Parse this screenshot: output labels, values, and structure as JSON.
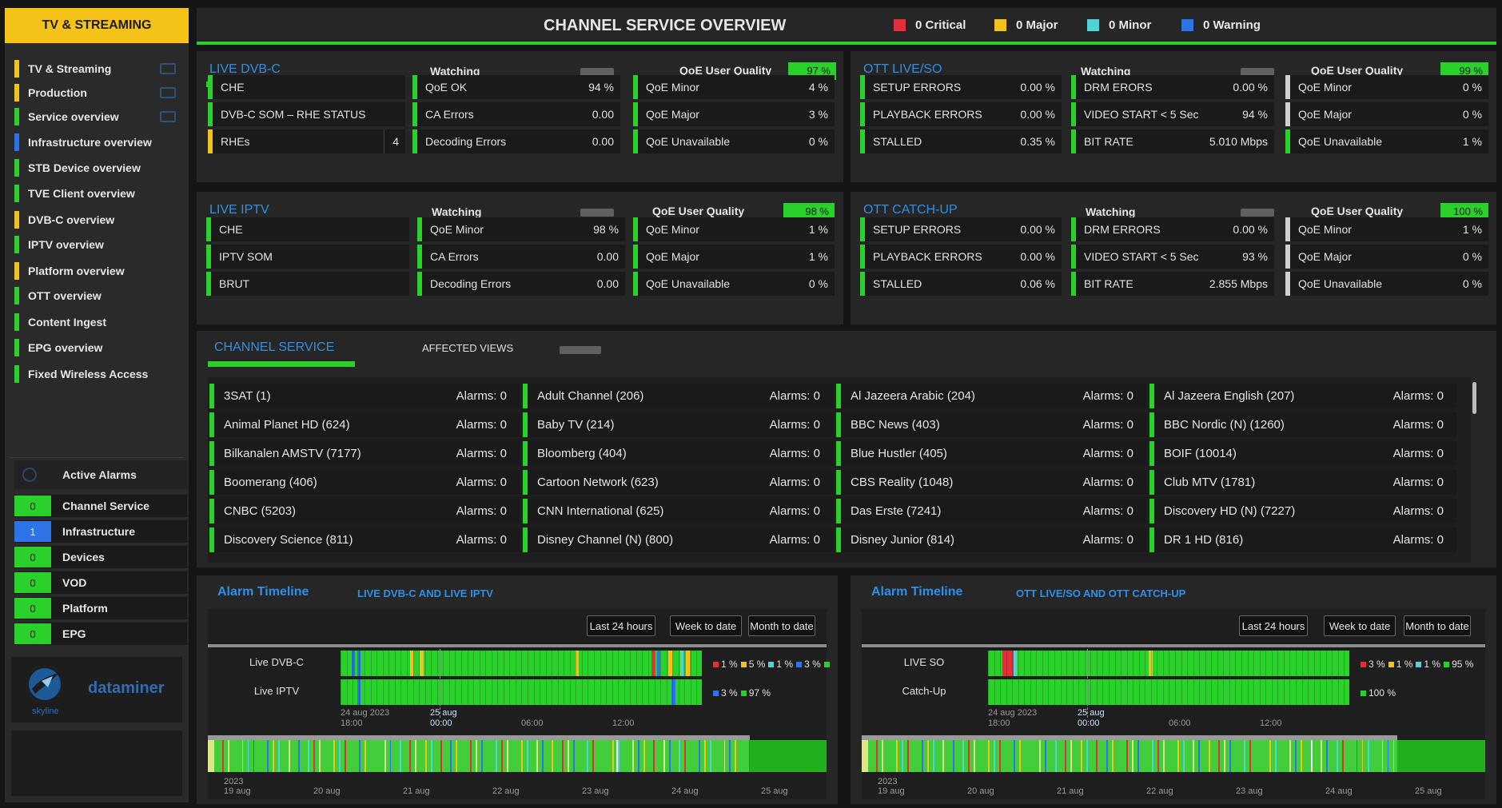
{
  "colors": {
    "green": "#2bd12b",
    "yellow": "#f1c21b",
    "critical": "#e0303a",
    "major": "#f1c21b",
    "minor": "#4fd2d8",
    "warning": "#2f74e6",
    "blue_title": "#2e8fe6"
  },
  "sidebar": {
    "title": "TV & STREAMING",
    "items": [
      {
        "label": "TV & Streaming",
        "color": "#f1c21b",
        "icon": true
      },
      {
        "label": "Production",
        "color": "#f1c21b",
        "icon": true
      },
      {
        "label": "Service overview",
        "color": "#2bd12b",
        "icon": true
      },
      {
        "label": "Infrastructure overview",
        "color": "#2f74e6",
        "icon": false
      },
      {
        "label": "STB Device overview",
        "color": "#2bd12b",
        "icon": false
      },
      {
        "label": "TVE Client overview",
        "color": "#2bd12b",
        "icon": false
      },
      {
        "label": "DVB-C overview",
        "color": "#f1c21b",
        "icon": false
      },
      {
        "label": "IPTV overview",
        "color": "#2bd12b",
        "icon": false
      },
      {
        "label": "Platform overview",
        "color": "#f1c21b",
        "icon": false
      },
      {
        "label": "OTT overview",
        "color": "#2bd12b",
        "icon": false
      },
      {
        "label": "Content Ingest",
        "color": "#2bd12b",
        "icon": false
      },
      {
        "label": "EPG overview",
        "color": "#2bd12b",
        "icon": false
      },
      {
        "label": "Fixed Wireless Access",
        "color": "#2bd12b",
        "icon": false
      }
    ],
    "alarms_title": "Active Alarms",
    "alarms": [
      {
        "count": "0",
        "label": "Channel Service",
        "color": "#2bd12b"
      },
      {
        "count": "1",
        "label": "Infrastructure",
        "color": "#2f74e6"
      },
      {
        "count": "0",
        "label": "Devices",
        "color": "#2bd12b"
      },
      {
        "count": "0",
        "label": "VOD",
        "color": "#2bd12b"
      },
      {
        "count": "0",
        "label": "Platform",
        "color": "#2bd12b"
      },
      {
        "count": "0",
        "label": "EPG",
        "color": "#2bd12b"
      }
    ],
    "logo_brand": "skyline",
    "logo_name": "dataminer"
  },
  "header": {
    "title": "CHANNEL SERVICE OVERVIEW",
    "legend": [
      {
        "label": "0 Critical",
        "color": "#e0303a"
      },
      {
        "label": "0 Major",
        "color": "#f1c21b"
      },
      {
        "label": "0 Minor",
        "color": "#4fd2d8"
      },
      {
        "label": "0 Warning",
        "color": "#2f74e6"
      }
    ]
  },
  "panels": [
    {
      "title": "LIVE DVB-C",
      "watching": "Watching",
      "qoe": "QoE User Quality",
      "qoe_value": "97 %",
      "cols": [
        [
          {
            "label": "CHE",
            "value": "",
            "color": "g"
          },
          {
            "label": "DVB-C SOM – RHE STATUS",
            "value": "",
            "color": "g"
          },
          {
            "label": "RHEs",
            "value": "4",
            "color": "y"
          }
        ],
        [
          {
            "label": "QoE OK",
            "value": "94 %",
            "color": "g"
          },
          {
            "label": "CA Errors",
            "value": "0.00",
            "color": "g"
          },
          {
            "label": "Decoding Errors",
            "value": "0.00",
            "color": "g"
          }
        ],
        [
          {
            "label": "QoE Minor",
            "value": "4 %",
            "color": "g"
          },
          {
            "label": "QoE Major",
            "value": "3 %",
            "color": "g"
          },
          {
            "label": "QoE Unavailable",
            "value": "0 %",
            "color": "g"
          }
        ]
      ]
    },
    {
      "title": "OTT LIVE/SO",
      "watching": "Watching",
      "qoe": "QoE User Quality",
      "qoe_value": "99 %",
      "cols": [
        [
          {
            "label": "SETUP ERRORS",
            "value": "0.00 %",
            "color": "g"
          },
          {
            "label": "PLAYBACK ERRORS",
            "value": "0.00 %",
            "color": "g"
          },
          {
            "label": "STALLED",
            "value": "0.35 %",
            "color": "g"
          }
        ],
        [
          {
            "label": "DRM ERORS",
            "value": "0.00 %",
            "color": "g"
          },
          {
            "label": "VIDEO START  < 5 Sec",
            "value": "94 %",
            "color": "g"
          },
          {
            "label": "BIT RATE",
            "value": "5.010 Mbps",
            "color": "g"
          }
        ],
        [
          {
            "label": "QoE Minor",
            "value": "0 %",
            "color": "w"
          },
          {
            "label": "QoE Major",
            "value": "0 %",
            "color": "w"
          },
          {
            "label": "QoE Unavailable",
            "value": "1 %",
            "color": "g"
          }
        ]
      ]
    },
    {
      "title": "LIVE IPTV",
      "watching": "Watching",
      "qoe": "QoE User Quality",
      "qoe_value": "98 %",
      "cols": [
        [
          {
            "label": "CHE",
            "value": "",
            "color": "g"
          },
          {
            "label": "IPTV SOM",
            "value": "",
            "color": "g"
          },
          {
            "label": "BRUT",
            "value": "",
            "color": "g"
          }
        ],
        [
          {
            "label": "QoE Minor",
            "value": "98 %",
            "color": "g"
          },
          {
            "label": "CA Errors",
            "value": "0.00",
            "color": "g"
          },
          {
            "label": "Decoding Errors",
            "value": "0.00",
            "color": "g"
          }
        ],
        [
          {
            "label": "QoE Minor",
            "value": "1 %",
            "color": "g"
          },
          {
            "label": "QoE Major",
            "value": "1 %",
            "color": "g"
          },
          {
            "label": "QoE Unavailable",
            "value": "0 %",
            "color": "g"
          }
        ]
      ]
    },
    {
      "title": "OTT CATCH-UP",
      "watching": "Watching",
      "qoe": "QoE User Quality",
      "qoe_value": "100 %",
      "cols": [
        [
          {
            "label": "SETUP ERRORS",
            "value": "0.00 %",
            "color": "g"
          },
          {
            "label": "PLAYBACK ERRORS",
            "value": "0.00 %",
            "color": "g"
          },
          {
            "label": "STALLED",
            "value": "0.06 %",
            "color": "g"
          }
        ],
        [
          {
            "label": "DRM ERRORS",
            "value": "0.00 %",
            "color": "g"
          },
          {
            "label": "VIDEO START  < 5 Sec",
            "value": "93 %",
            "color": "g"
          },
          {
            "label": "BIT RATE",
            "value": "2.855 Mbps",
            "color": "g"
          }
        ],
        [
          {
            "label": "QoE Minor",
            "value": "1 %",
            "color": "w"
          },
          {
            "label": "QoE Major",
            "value": "0 %",
            "color": "w"
          },
          {
            "label": "QoE Unavailable",
            "value": "0 %",
            "color": "w"
          }
        ]
      ]
    }
  ],
  "channels": {
    "title": "CHANNEL SERVICE",
    "affected": "AFFECTED VIEWS",
    "list": [
      [
        "3SAT (1)",
        "Alarms: 0"
      ],
      [
        "Adult Channel (206)",
        "Alarms: 0"
      ],
      [
        "Al Jazeera Arabic (204)",
        "Alarms: 0"
      ],
      [
        "Al Jazeera English (207)",
        "Alarms: 0"
      ],
      [
        "Animal Planet HD (624)",
        "Alarms: 0"
      ],
      [
        "Baby TV (214)",
        "Alarms: 0"
      ],
      [
        "BBC News (403)",
        "Alarms: 0"
      ],
      [
        "BBC Nordic (N) (1260)",
        "Alarms: 0"
      ],
      [
        "Bilkanalen AMSTV (7177)",
        "Alarms: 0"
      ],
      [
        "Bloomberg (404)",
        "Alarms: 0"
      ],
      [
        "Blue Hustler (405)",
        "Alarms: 0"
      ],
      [
        "BOIF (10014)",
        "Alarms: 0"
      ],
      [
        "Boomerang (406)",
        "Alarms: 0"
      ],
      [
        "Cartoon Network (623)",
        "Alarms: 0"
      ],
      [
        "CBS Reality (1048)",
        "Alarms: 0"
      ],
      [
        "Club MTV (1781)",
        "Alarms: 0"
      ],
      [
        "CNBC (5203)",
        "Alarms: 0"
      ],
      [
        "CNN International (625)",
        "Alarms: 0"
      ],
      [
        "Das Erste (7241)",
        "Alarms: 0"
      ],
      [
        "Discovery HD (N) (7227)",
        "Alarms: 0"
      ],
      [
        "Discovery Science (811)",
        "Alarms: 0"
      ],
      [
        "Disney Channel (N) (800)",
        "Alarms: 0"
      ],
      [
        "Disney Junior (814)",
        "Alarms: 0"
      ],
      [
        "DR 1 HD (816)",
        "Alarms: 0"
      ]
    ]
  },
  "timelines": [
    {
      "title": "Alarm Timeline",
      "subtitle": "LIVE DVB-C AND LIVE IPTV",
      "buttons": [
        "Last 24 hours",
        "Week to date",
        "Month to date"
      ],
      "rows": [
        {
          "label": "Live DVB-C",
          "stats": [
            {
              "c": "#e0303a",
              "t": "1 %"
            },
            {
              "c": "#f1c21b",
              "t": "5 %"
            },
            {
              "c": "#4fd2d8",
              "t": "1 %"
            },
            {
              "c": "#2f74e6",
              "t": "3 %"
            },
            {
              "c": "#2bd12b",
              "t": ""
            }
          ]
        },
        {
          "label": "Live IPTV",
          "stats": [
            {
              "c": "#2f74e6",
              "t": "3 %"
            },
            {
              "c": "#2bd12b",
              "t": "97 %"
            }
          ]
        }
      ],
      "ticks": [
        {
          "a": "24 aug 2023",
          "b": "18:00"
        },
        {
          "a": "25 aug",
          "b": "00:00"
        },
        {
          "a": "",
          "b": "06:00"
        },
        {
          "a": "",
          "b": "12:00"
        }
      ],
      "overview_ticks": [
        "19 aug",
        "20 aug",
        "21 aug",
        "22 aug",
        "23 aug",
        "24 aug",
        "25 aug"
      ],
      "overview_year": "2023"
    },
    {
      "title": "Alarm Timeline",
      "subtitle": "OTT LIVE/SO AND OTT CATCH-UP",
      "buttons": [
        "Last 24 hours",
        "Week to date",
        "Month to date"
      ],
      "rows": [
        {
          "label": "LIVE SO",
          "stats": [
            {
              "c": "#e0303a",
              "t": "3 %"
            },
            {
              "c": "#f1c21b",
              "t": "1 %"
            },
            {
              "c": "#4fd2d8",
              "t": "1 %"
            },
            {
              "c": "#2bd12b",
              "t": "95 %"
            }
          ]
        },
        {
          "label": "Catch-Up",
          "stats": [
            {
              "c": "#2bd12b",
              "t": "100 %"
            }
          ]
        }
      ],
      "ticks": [
        {
          "a": "24 aug 2023",
          "b": "18:00"
        },
        {
          "a": "25 aug",
          "b": "00:00"
        },
        {
          "a": "",
          "b": "06:00"
        },
        {
          "a": "",
          "b": "12:00"
        }
      ],
      "overview_ticks": [
        "19 aug",
        "20 aug",
        "21 aug",
        "22 aug",
        "23 aug",
        "24 aug",
        "25 aug"
      ],
      "overview_year": "2023"
    }
  ]
}
